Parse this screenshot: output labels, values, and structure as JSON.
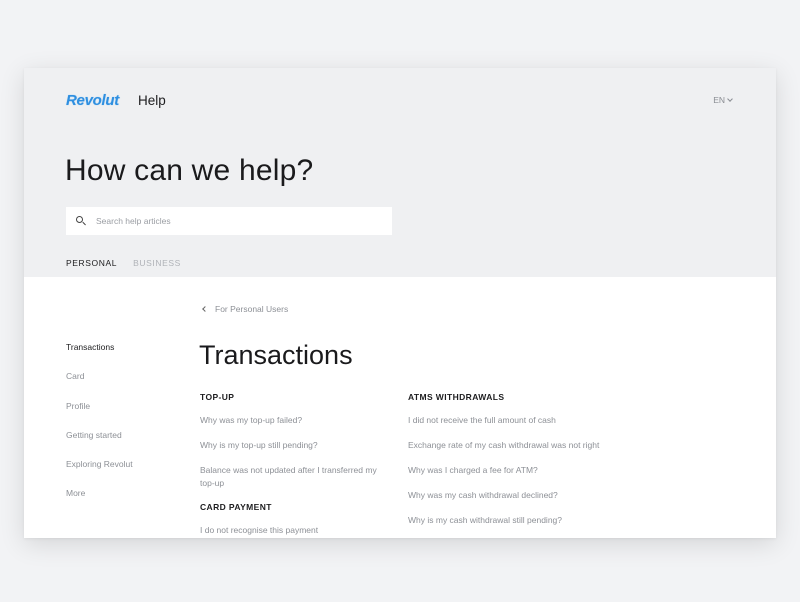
{
  "header": {
    "logo": "Revolut",
    "help": "Help",
    "lang": "EN"
  },
  "hero": {
    "title": "How can we help?",
    "search_placeholder": "Search help articles"
  },
  "tabs": [
    "PERSONAL",
    "BUSINESS"
  ],
  "sidebar": {
    "items": [
      "Transactions",
      "Card",
      "Profile",
      "Getting started",
      "Exploring Revolut",
      "More"
    ]
  },
  "breadcrumb": "For Personal Users",
  "page_title": "Transactions",
  "sections": {
    "topup": {
      "heading": "TOP-UP",
      "links": [
        "Why was my top-up failed?",
        "Why is my top-up still pending?",
        "Balance was not updated after I transferred my top-up"
      ]
    },
    "card_payment": {
      "heading": "CARD PAYMENT",
      "links": [
        "I do not recognise this payment"
      ]
    },
    "atm": {
      "heading": "ATMS WITHDRAWALS",
      "links": [
        "I did not receive the full amount of cash",
        "Exchange rate of my cash withdrawal was not right",
        "Why was I charged a fee for ATM?",
        "Why was my cash withdrawal declined?",
        "Why is my cash withdrawal still pending?"
      ]
    }
  },
  "colors": {
    "brand": "#2f8fe0",
    "hero_bg": "#eff0f2",
    "muted_text": "#8d9096"
  }
}
